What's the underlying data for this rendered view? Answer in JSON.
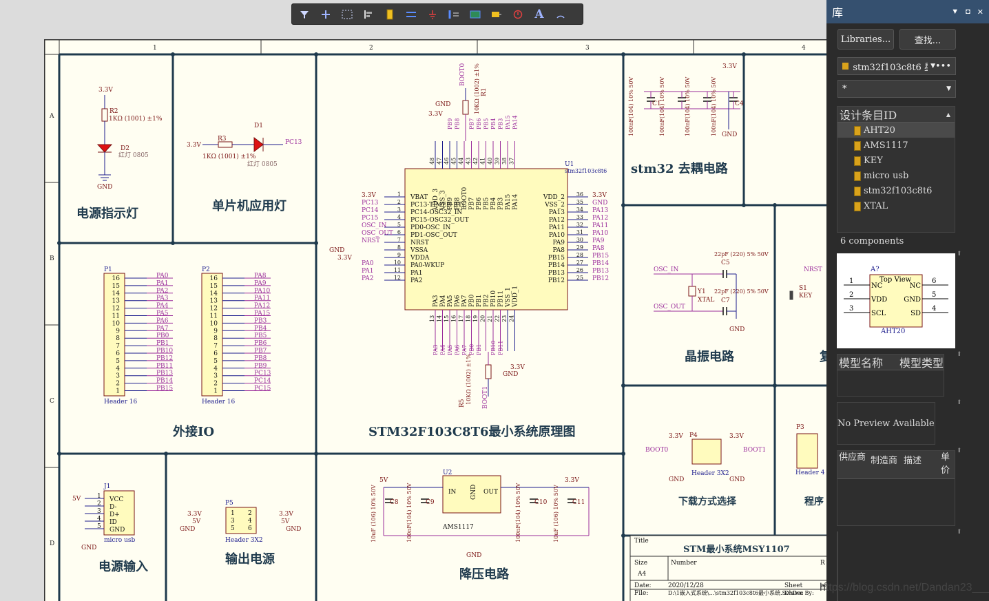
{
  "toolbar": {
    "buttons": [
      "filter",
      "add-wire",
      "select-rect",
      "align",
      "part",
      "bus",
      "ground",
      "port",
      "net",
      "harness",
      "stop",
      "text",
      "arc"
    ]
  },
  "panel": {
    "title": "库",
    "libraries_button": "Libraries...",
    "search_button": "查找...",
    "library_dropdown": "stm32f103c8t6 星",
    "filter_value": "*",
    "list_header": "设计条目ID",
    "components": [
      "AHT20",
      "AMS1117",
      "KEY",
      "micro usb",
      "stm32f103c8t6",
      "XTAL"
    ],
    "selected": "AHT20",
    "count": "6 components",
    "model_name": "模型名称",
    "model_type": "模型类型",
    "no_preview": "No Preview Available",
    "supplier": "供应商",
    "manufacturer": "制造商",
    "description": "描述",
    "unit_price": "单价",
    "preview": {
      "designator": "A?",
      "top_view": "Top View",
      "part": "AHT20",
      "pins_left": [
        [
          "1",
          "NC"
        ],
        [
          "2",
          "VDD"
        ],
        [
          "3",
          "SCL"
        ]
      ],
      "pins_right": [
        [
          "6",
          "NC"
        ],
        [
          "5",
          "GND"
        ],
        [
          "4",
          "SD"
        ]
      ]
    }
  },
  "schematic": {
    "col_markers": [
      "1",
      "2",
      "3",
      "4"
    ],
    "row_markers": [
      "A",
      "B",
      "C",
      "D"
    ],
    "blocks": {
      "power_led": "电源指示灯",
      "mcu_led": "单片机应用灯",
      "ext_io": "外接IO",
      "mcu_title": "STM32F103C8T6最小系统原理图",
      "decoupling": "stm32 去耦电路",
      "crystal": "晶振电路",
      "download": "下载方式选择",
      "program": "程序",
      "reset": "复",
      "power_in": "电源输入",
      "power_out": "输出电源",
      "buck": "降压电路"
    },
    "title_block": {
      "title_label": "Title",
      "title": "STM最小系统MSY1107",
      "size_label": "Size",
      "size": "A4",
      "number_label": "Number",
      "rev_label": "R",
      "date_label": "Date:",
      "date": "2020/12/28",
      "sheet_label": "Sheet",
      "sheet_of": "of",
      "file_label": "File:",
      "file": "D:\\1嵌入式系统\\...\\stm32f103c8t6最小系统.SchDoc",
      "drawn_by": "Drawn By:"
    },
    "watermark": "https://blog.csdn.net/Dandan23___",
    "mcu": {
      "designator": "U1",
      "part": "stm32f103c8t6",
      "left_pins": [
        [
          "1",
          "VBAT",
          "3.3V"
        ],
        [
          "2",
          "PC13-TIMER-RTC",
          "PC13"
        ],
        [
          "3",
          "PC14-OSC32_IN",
          "PC14"
        ],
        [
          "4",
          "PC15-OSC32_OUT",
          "PC15"
        ],
        [
          "5",
          "PD0-OSC_IN",
          "OSC_IN"
        ],
        [
          "6",
          "PD1-OSC_OUT",
          "OSC_OUT"
        ],
        [
          "7",
          "NRST",
          "NRST"
        ],
        [
          "8",
          "VSSA",
          ""
        ],
        [
          "9",
          "VDDA",
          ""
        ],
        [
          "10",
          "PA0-WKUP",
          "PA0"
        ],
        [
          "11",
          "PA1",
          "PA1"
        ],
        [
          "12",
          "PA2",
          "PA2"
        ]
      ],
      "right_pins": [
        [
          "36",
          "VDD_2",
          "3.3V"
        ],
        [
          "35",
          "VSS_2",
          "GND"
        ],
        [
          "34",
          "PA13",
          "PA13"
        ],
        [
          "33",
          "PA12",
          "PA12"
        ],
        [
          "32",
          "PA11",
          "PA11"
        ],
        [
          "31",
          "PA10",
          "PA10"
        ],
        [
          "30",
          "PA9",
          "PA9"
        ],
        [
          "29",
          "PA8",
          "PA8"
        ],
        [
          "28",
          "PB15",
          "PB15"
        ],
        [
          "27",
          "PB14",
          "PB14"
        ],
        [
          "26",
          "PB13",
          "PB13"
        ],
        [
          "25",
          "PB12",
          "PB12"
        ]
      ],
      "top_pins": [
        [
          "48",
          "VDD_3"
        ],
        [
          "47",
          "VSS_3"
        ],
        [
          "46",
          "PB9"
        ],
        [
          "45",
          "PB8"
        ],
        [
          "44",
          "BOOT0"
        ],
        [
          "43",
          "PB7"
        ],
        [
          "42",
          "PB6"
        ],
        [
          "41",
          "PB5"
        ],
        [
          "40",
          "PB4"
        ],
        [
          "39",
          "PB3"
        ],
        [
          "38",
          "PA15"
        ],
        [
          "37",
          "PA14"
        ]
      ],
      "bottom_pins": [
        [
          "13",
          "PA3"
        ],
        [
          "14",
          "PA4"
        ],
        [
          "15",
          "PA5"
        ],
        [
          "16",
          "PA6"
        ],
        [
          "17",
          "PA7"
        ],
        [
          "18",
          "PB0"
        ],
        [
          "19",
          "PB1"
        ],
        [
          "20",
          "PB2"
        ],
        [
          "21",
          "PB10"
        ],
        [
          "22",
          "PB11"
        ],
        [
          "23",
          "VSS_1"
        ],
        [
          "24",
          "VDD_1"
        ]
      ]
    },
    "headers": {
      "p1": {
        "ref": "P1",
        "name": "Header 16",
        "nets": [
          "PA0",
          "PA1",
          "PA2",
          "PA3",
          "PA4",
          "PA5",
          "PA6",
          "PA7",
          "PB0",
          "PB1",
          "PB10",
          "PB12",
          "PB11",
          "PB13",
          "PB14",
          "PB15"
        ]
      },
      "p2": {
        "ref": "P2",
        "name": "Header 16",
        "nets": [
          "PA8",
          "PA9",
          "PA10",
          "PA11",
          "PA12",
          "PA15",
          "PB3",
          "PB4",
          "PB5",
          "PB6",
          "PB7",
          "PB8",
          "PB9",
          "PC13",
          "PC14",
          "PC15"
        ]
      }
    },
    "texts": {
      "r2": "R2",
      "r2v": "1KΩ (1001) ±1%",
      "d2": "D2",
      "d2v": "红灯 0805",
      "r3": "R3",
      "r3v": "1KΩ (1001) ±1%",
      "d1": "D1",
      "d1v": "红灯 0805",
      "r1": "R1",
      "r1v": "10KΩ (1002) ±1%",
      "r5": "R5",
      "r5v": "10KΩ (1002) ±1%",
      "v33": "3.3V",
      "gnd": "GND",
      "v5": "5V",
      "boot0": "BOOT0",
      "boot1": "BOOT1",
      "osc_in": "OSC_IN",
      "osc_out": "OSC_OUT",
      "y1": "Y1",
      "xtal": "XTAL",
      "c5": "C5",
      "c7": "C7",
      "c22p": "22pF (220) 5% 50V",
      "c1": "C1",
      "c4": "C4",
      "c100n": "100nF(104) 10% 50V",
      "c8": "C8",
      "c9": "C9",
      "c10": "C10",
      "c11": "C11",
      "c10u": "10uF (106) 10% 50V",
      "c100n2": "100nF(104) 10% 50V",
      "u2": "U2",
      "ams": "AMS1117",
      "in": "IN",
      "out": "OUT",
      "gndpin": "GND",
      "j1": "J1",
      "usb": "micro usb",
      "p4": "P4",
      "h3x2": "Header 3X2",
      "p5": "P5",
      "p3": "P3",
      "h4": "Header 4",
      "s1": "S1",
      "key": "KEY",
      "nrst": "NRST",
      "vcc": "VCC",
      "dm": "D-",
      "dp": "D+",
      "id": "ID"
    }
  }
}
